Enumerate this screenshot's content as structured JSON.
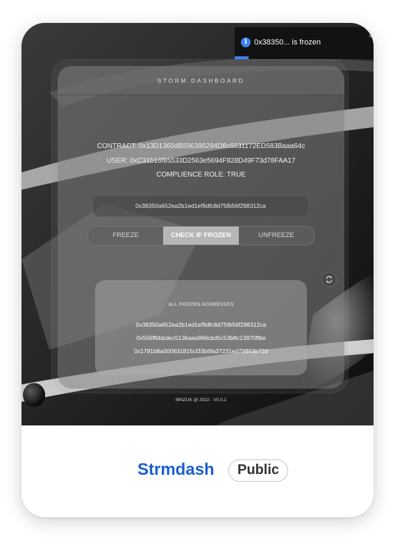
{
  "toast": {
    "message": "0x38350... is frozen",
    "icon": "info-icon",
    "accent": "#3b82f6"
  },
  "dashboard": {
    "title": "STORM.DASHBOARD",
    "contract_line": "CONTRACT: 0x13D1365dB556395294D8c6631172ED583Baaa64c",
    "user_line": "USER: 0xC31b16f85533D2563e5694F828D49F73d78FAA17",
    "role_line": "COMPLIENCE ROLE: TRUE",
    "address_input": "0x38350a652ea2b1ed1ef9dfc8d75fb56f298312ca",
    "actions": {
      "freeze": "FREEZE",
      "check": "CHECK IF FROZEN",
      "unfreeze": "UNFREEZE",
      "active": "check"
    },
    "frozen": {
      "title": "ALL FROZEN ADDRESSES",
      "items": [
        "0x38350a652ea2b1ed1ef9dfc8d75fb56f298312ca",
        "0x556ffbbbdec513baaa966cbd5c53b8c13870ffbe",
        "0x1791b8a000631815cf33b6fa37231ed79893b72d"
      ]
    },
    "footer": "IBNZUK @ 2022 - V0.0.1"
  },
  "repo": {
    "name": "Strmdash",
    "visibility": "Public",
    "name_color": "#1b5fd1"
  }
}
